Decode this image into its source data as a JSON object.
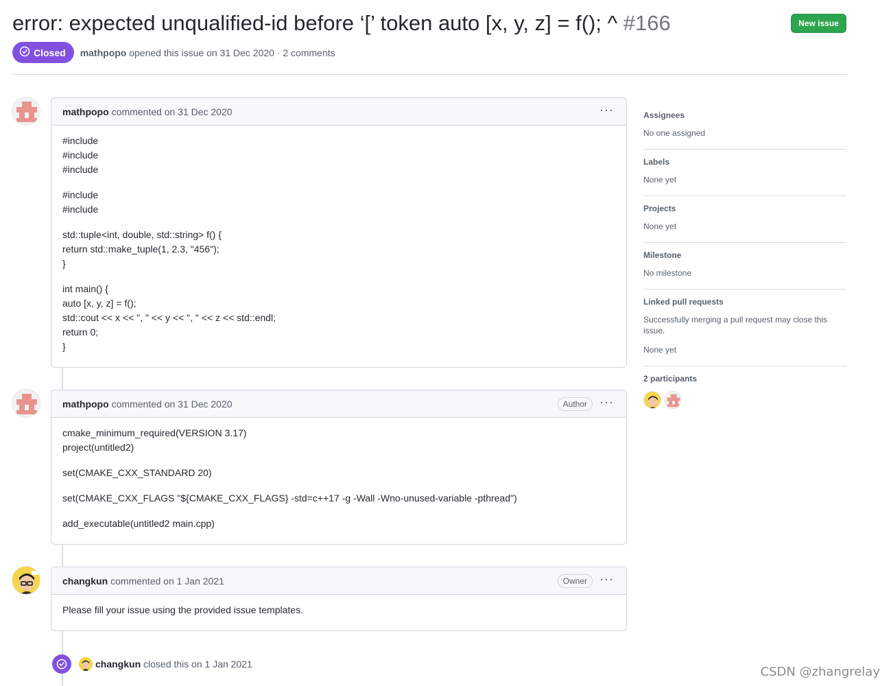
{
  "issue": {
    "title": "error: expected unqualified-id before ‘[’ token auto [x, y, z] = f(); ^",
    "number": "#166",
    "state": "Closed",
    "author": "mathpopo",
    "opened_text": "opened this issue on 31 Dec 2020 · 2 comments"
  },
  "toolbar": {
    "new_issue_label": "New issue"
  },
  "colors": {
    "closed_purple": "#8250df",
    "new_issue_green": "#2da44e"
  },
  "comments": [
    {
      "author": "mathpopo",
      "action": "commented on 31 Dec 2020",
      "badge": "",
      "body": [
        "#include",
        "#include",
        "#include",
        "",
        "#include",
        "#include",
        "",
        "std::tuple<int, double, std::string> f() {",
        "return std::make_tuple(1, 2.3, \"456\");",
        "}",
        "",
        "int main() {",
        "auto [x, y, z] = f();",
        "std::cout << x << \", \" << y << \", \" << z << std::endl;",
        "return 0;",
        "}"
      ]
    },
    {
      "author": "mathpopo",
      "action": "commented on 31 Dec 2020",
      "badge": "Author",
      "body": [
        "cmake_minimum_required(VERSION 3.17)",
        "project(untitled2)",
        "",
        "set(CMAKE_CXX_STANDARD 20)",
        "",
        "set(CMAKE_CXX_FLAGS \"${CMAKE_CXX_FLAGS} -std=c++17 -g -Wall -Wno-unused-variable -pthread\")",
        "",
        "add_executable(untitled2 main.cpp)"
      ]
    },
    {
      "author": "changkun",
      "action": "commented on 1 Jan 2021",
      "badge": "Owner",
      "body": [
        "Please fill your issue using the provided issue templates."
      ]
    }
  ],
  "event": {
    "actor": "changkun",
    "text": "closed this on 1 Jan 2021"
  },
  "sidebar": {
    "assignees": {
      "title": "Assignees",
      "value": "No one assigned"
    },
    "labels": {
      "title": "Labels",
      "value": "None yet"
    },
    "projects": {
      "title": "Projects",
      "value": "None yet"
    },
    "milestone": {
      "title": "Milestone",
      "value": "No milestone"
    },
    "linked_prs": {
      "title": "Linked pull requests",
      "note": "Successfully merging a pull request may close this issue.",
      "value": "None yet"
    },
    "participants": {
      "title": "2 participants"
    }
  },
  "watermark": "CSDN @zhangrelay"
}
